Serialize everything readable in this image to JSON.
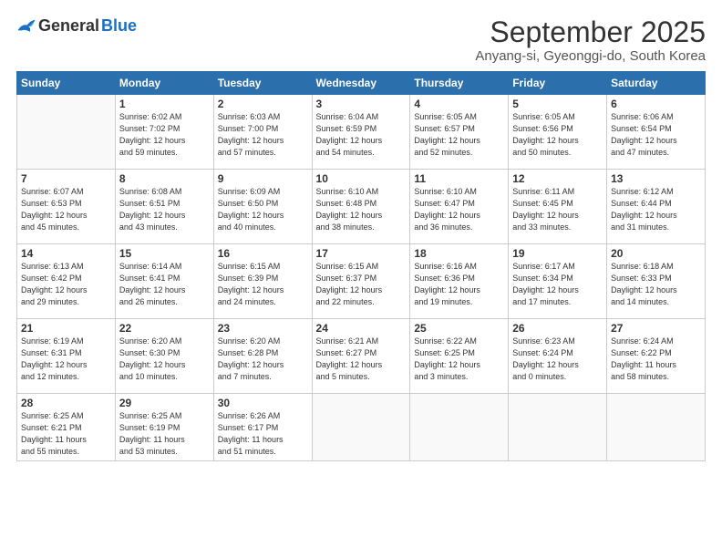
{
  "logo": {
    "general": "General",
    "blue": "Blue"
  },
  "title": "September 2025",
  "location": "Anyang-si, Gyeonggi-do, South Korea",
  "weekdays": [
    "Sunday",
    "Monday",
    "Tuesday",
    "Wednesday",
    "Thursday",
    "Friday",
    "Saturday"
  ],
  "weeks": [
    [
      {
        "day": "",
        "info": ""
      },
      {
        "day": "1",
        "info": "Sunrise: 6:02 AM\nSunset: 7:02 PM\nDaylight: 12 hours\nand 59 minutes."
      },
      {
        "day": "2",
        "info": "Sunrise: 6:03 AM\nSunset: 7:00 PM\nDaylight: 12 hours\nand 57 minutes."
      },
      {
        "day": "3",
        "info": "Sunrise: 6:04 AM\nSunset: 6:59 PM\nDaylight: 12 hours\nand 54 minutes."
      },
      {
        "day": "4",
        "info": "Sunrise: 6:05 AM\nSunset: 6:57 PM\nDaylight: 12 hours\nand 52 minutes."
      },
      {
        "day": "5",
        "info": "Sunrise: 6:05 AM\nSunset: 6:56 PM\nDaylight: 12 hours\nand 50 minutes."
      },
      {
        "day": "6",
        "info": "Sunrise: 6:06 AM\nSunset: 6:54 PM\nDaylight: 12 hours\nand 47 minutes."
      }
    ],
    [
      {
        "day": "7",
        "info": "Sunrise: 6:07 AM\nSunset: 6:53 PM\nDaylight: 12 hours\nand 45 minutes."
      },
      {
        "day": "8",
        "info": "Sunrise: 6:08 AM\nSunset: 6:51 PM\nDaylight: 12 hours\nand 43 minutes."
      },
      {
        "day": "9",
        "info": "Sunrise: 6:09 AM\nSunset: 6:50 PM\nDaylight: 12 hours\nand 40 minutes."
      },
      {
        "day": "10",
        "info": "Sunrise: 6:10 AM\nSunset: 6:48 PM\nDaylight: 12 hours\nand 38 minutes."
      },
      {
        "day": "11",
        "info": "Sunrise: 6:10 AM\nSunset: 6:47 PM\nDaylight: 12 hours\nand 36 minutes."
      },
      {
        "day": "12",
        "info": "Sunrise: 6:11 AM\nSunset: 6:45 PM\nDaylight: 12 hours\nand 33 minutes."
      },
      {
        "day": "13",
        "info": "Sunrise: 6:12 AM\nSunset: 6:44 PM\nDaylight: 12 hours\nand 31 minutes."
      }
    ],
    [
      {
        "day": "14",
        "info": "Sunrise: 6:13 AM\nSunset: 6:42 PM\nDaylight: 12 hours\nand 29 minutes."
      },
      {
        "day": "15",
        "info": "Sunrise: 6:14 AM\nSunset: 6:41 PM\nDaylight: 12 hours\nand 26 minutes."
      },
      {
        "day": "16",
        "info": "Sunrise: 6:15 AM\nSunset: 6:39 PM\nDaylight: 12 hours\nand 24 minutes."
      },
      {
        "day": "17",
        "info": "Sunrise: 6:15 AM\nSunset: 6:37 PM\nDaylight: 12 hours\nand 22 minutes."
      },
      {
        "day": "18",
        "info": "Sunrise: 6:16 AM\nSunset: 6:36 PM\nDaylight: 12 hours\nand 19 minutes."
      },
      {
        "day": "19",
        "info": "Sunrise: 6:17 AM\nSunset: 6:34 PM\nDaylight: 12 hours\nand 17 minutes."
      },
      {
        "day": "20",
        "info": "Sunrise: 6:18 AM\nSunset: 6:33 PM\nDaylight: 12 hours\nand 14 minutes."
      }
    ],
    [
      {
        "day": "21",
        "info": "Sunrise: 6:19 AM\nSunset: 6:31 PM\nDaylight: 12 hours\nand 12 minutes."
      },
      {
        "day": "22",
        "info": "Sunrise: 6:20 AM\nSunset: 6:30 PM\nDaylight: 12 hours\nand 10 minutes."
      },
      {
        "day": "23",
        "info": "Sunrise: 6:20 AM\nSunset: 6:28 PM\nDaylight: 12 hours\nand 7 minutes."
      },
      {
        "day": "24",
        "info": "Sunrise: 6:21 AM\nSunset: 6:27 PM\nDaylight: 12 hours\nand 5 minutes."
      },
      {
        "day": "25",
        "info": "Sunrise: 6:22 AM\nSunset: 6:25 PM\nDaylight: 12 hours\nand 3 minutes."
      },
      {
        "day": "26",
        "info": "Sunrise: 6:23 AM\nSunset: 6:24 PM\nDaylight: 12 hours\nand 0 minutes."
      },
      {
        "day": "27",
        "info": "Sunrise: 6:24 AM\nSunset: 6:22 PM\nDaylight: 11 hours\nand 58 minutes."
      }
    ],
    [
      {
        "day": "28",
        "info": "Sunrise: 6:25 AM\nSunset: 6:21 PM\nDaylight: 11 hours\nand 55 minutes."
      },
      {
        "day": "29",
        "info": "Sunrise: 6:25 AM\nSunset: 6:19 PM\nDaylight: 11 hours\nand 53 minutes."
      },
      {
        "day": "30",
        "info": "Sunrise: 6:26 AM\nSunset: 6:17 PM\nDaylight: 11 hours\nand 51 minutes."
      },
      {
        "day": "",
        "info": ""
      },
      {
        "day": "",
        "info": ""
      },
      {
        "day": "",
        "info": ""
      },
      {
        "day": "",
        "info": ""
      }
    ]
  ]
}
